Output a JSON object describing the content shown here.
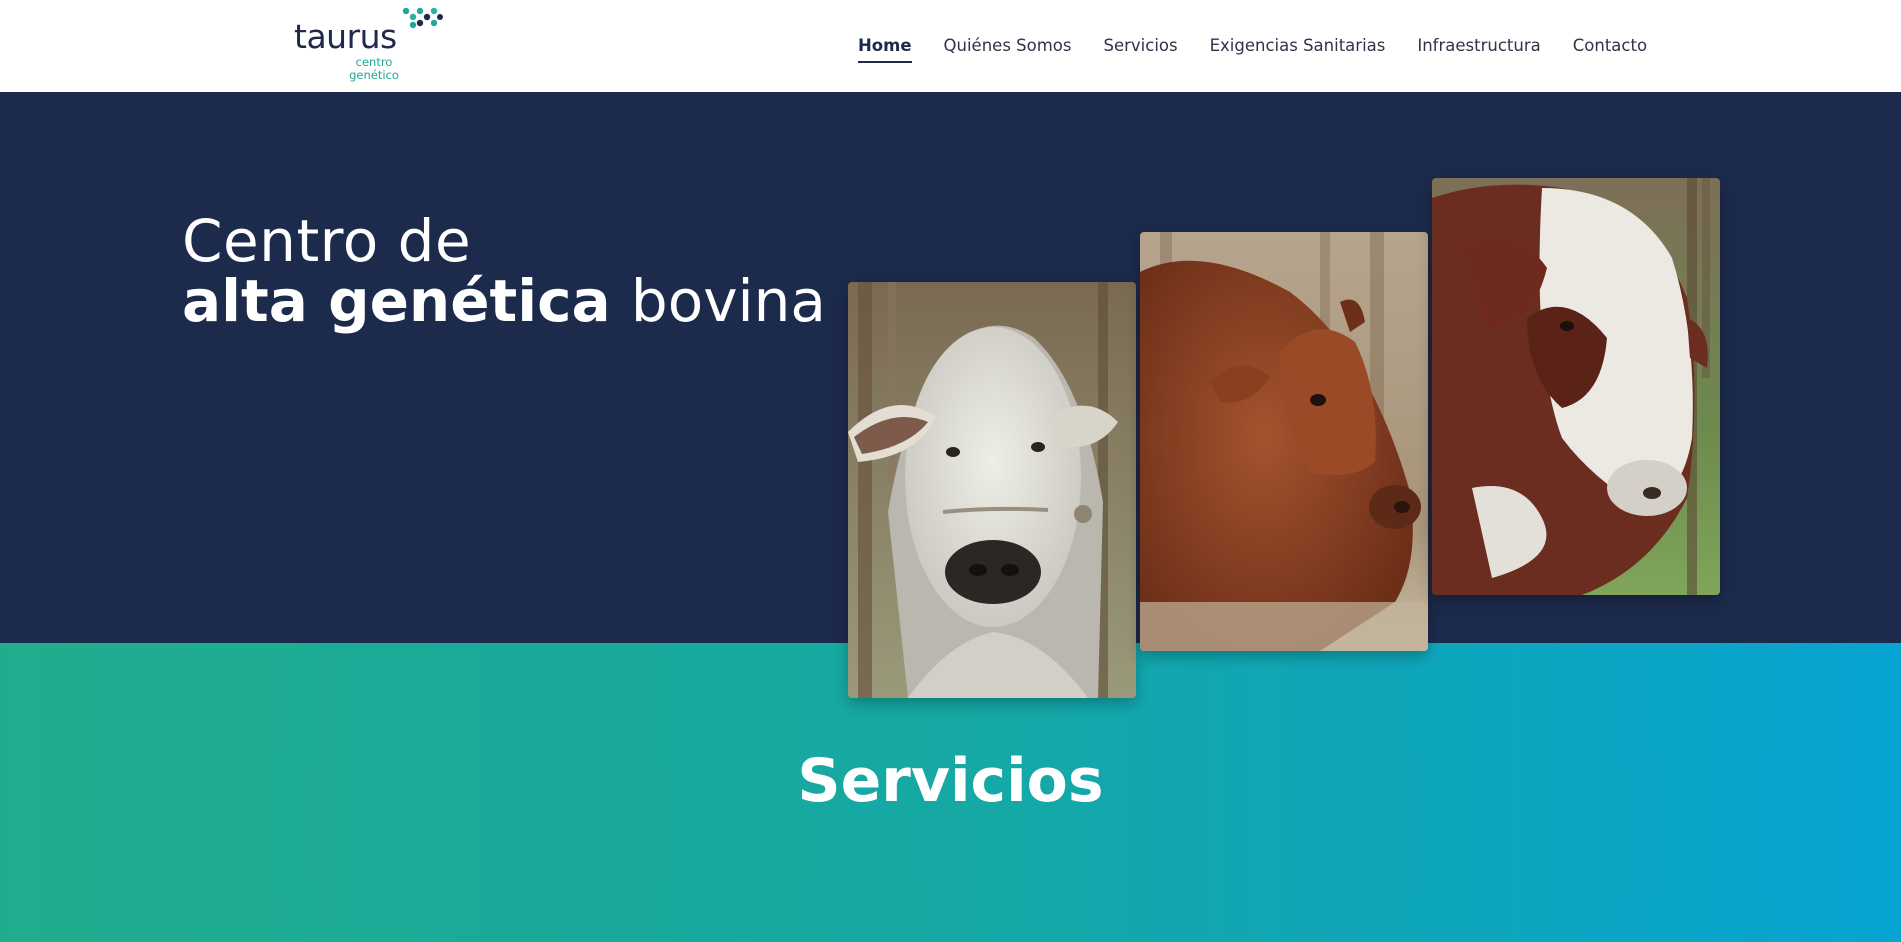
{
  "header": {
    "logo": {
      "wordmark": "taurus",
      "sub_line1": "centro",
      "sub_line2": "genético",
      "brand_color": "#1d2a4a",
      "accent_color": "#1fa79b"
    },
    "nav": {
      "items": [
        {
          "label": "Home",
          "active": true
        },
        {
          "label": "Quiénes Somos",
          "active": false
        },
        {
          "label": "Servicios",
          "active": false
        },
        {
          "label": "Exigencias Sanitarias",
          "active": false
        },
        {
          "label": "Infraestructura",
          "active": false
        },
        {
          "label": "Contacto",
          "active": false
        }
      ]
    }
  },
  "hero": {
    "line1": "Centro de",
    "line2_bold": "alta genética",
    "line2_light": "bovina",
    "background_color": "#1c2a4b",
    "photos": [
      {
        "subject": "white-zebu-bull-photo"
      },
      {
        "subject": "red-bull-photo"
      },
      {
        "subject": "red-and-white-bull-photo"
      }
    ]
  },
  "services": {
    "title": "Servicios",
    "gradient": [
      "#21ad8d",
      "#08a4d2"
    ]
  }
}
